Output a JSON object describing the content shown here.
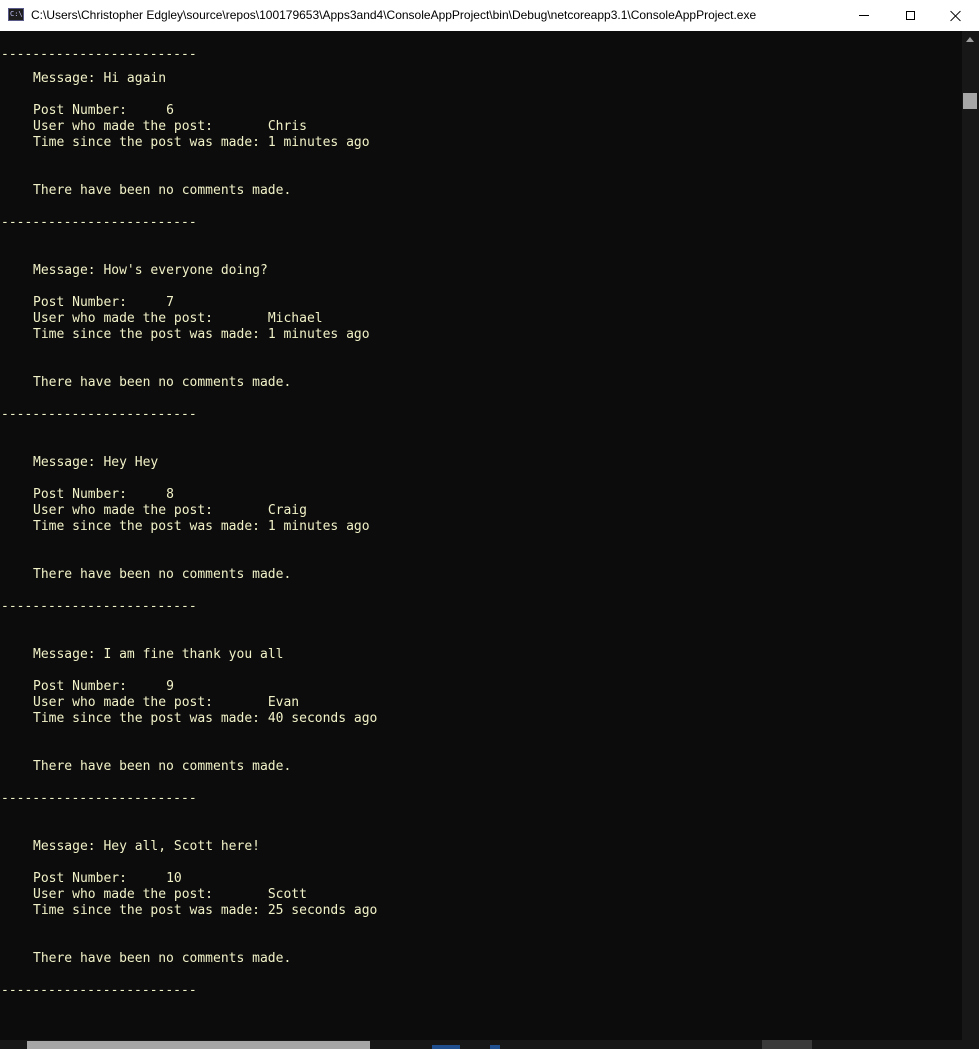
{
  "window": {
    "title": "C:\\Users\\Christopher Edgley\\source\\repos\\100179653\\Apps3and4\\ConsoleAppProject\\bin\\Debug\\netcoreapp3.1\\ConsoleAppProject.exe",
    "icon": "console-icon",
    "icon_glyph": "C:\\",
    "buttons": [
      "minimize-icon",
      "maximize-icon",
      "close-icon"
    ]
  },
  "console": {
    "separator": "-------------------------",
    "labels": {
      "message": "Message: ",
      "post_number": "Post Number:     ",
      "user": "User who made the post:       ",
      "time": "Time since the post was made: "
    },
    "posts": [
      {
        "message": "Hi again",
        "number": "6",
        "user": "Chris",
        "time": "1 minutes ago",
        "comments": "There have been no comments made."
      },
      {
        "message": "How's everyone doing?",
        "number": "7",
        "user": "Michael",
        "time": "1 minutes ago",
        "comments": "There have been no comments made."
      },
      {
        "message": "Hey Hey",
        "number": "8",
        "user": "Craig",
        "time": "1 minutes ago",
        "comments": "There have been no comments made."
      },
      {
        "message": "I am fine thank you all",
        "number": "9",
        "user": "Evan",
        "time": "40 seconds ago",
        "comments": "There have been no comments made."
      },
      {
        "message": "Hey all, Scott here!",
        "number": "10",
        "user": "Scott",
        "time": "25 seconds ago",
        "comments": "There have been no comments made."
      }
    ]
  },
  "colors": {
    "background": "#0c0c0c",
    "text": "#f2f2c8",
    "titlebar": "#ffffff"
  }
}
